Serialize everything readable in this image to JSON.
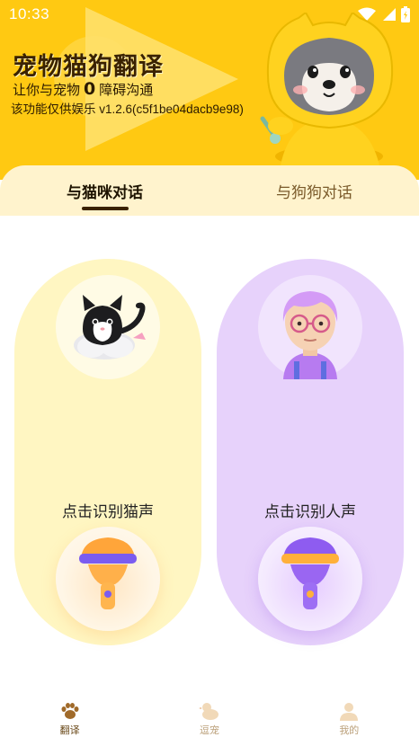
{
  "status_bar": {
    "time": "10:33"
  },
  "header": {
    "title": "宠物猫狗翻译",
    "subtitle_before": "让你与宠物",
    "subtitle_zero": "0",
    "subtitle_after": "障碍沟通",
    "version": "该功能仅供娱乐 v1.2.6(c5f1be04dacb9e98)"
  },
  "tabs": [
    {
      "label": "与猫咪对话",
      "active": true
    },
    {
      "label": "与狗狗对话",
      "active": false
    }
  ],
  "cards": {
    "cat": {
      "label": "点击识别猫声"
    },
    "human": {
      "label": "点击识别人声"
    }
  },
  "bottom_nav": [
    {
      "label": "翻译",
      "icon": "paw-icon",
      "active": true
    },
    {
      "label": "逗宠",
      "icon": "duck-icon",
      "active": false
    },
    {
      "label": "我的",
      "icon": "person-icon",
      "active": false
    }
  ],
  "colors": {
    "hero_bg": "#ffc912",
    "cat_card": "#fff6c2",
    "human_card": "#e7d2fb",
    "title_text": "#3a2200"
  }
}
